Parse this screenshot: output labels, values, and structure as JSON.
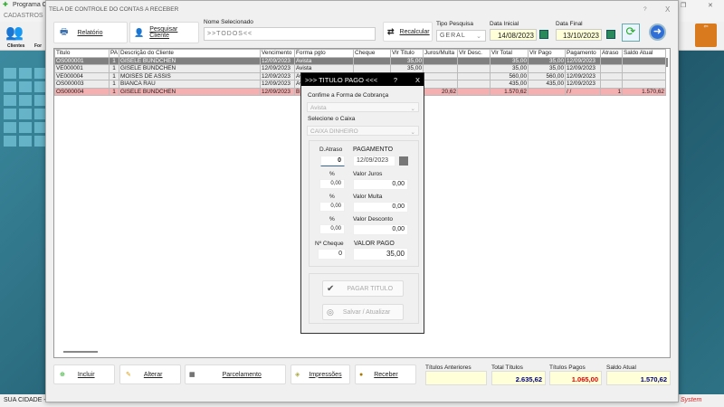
{
  "app": {
    "title": "Programa C",
    "menu": "CADASTROS",
    "tools": [
      "Clientes",
      "For"
    ],
    "status_left": "SUA CIDADE -",
    "status_right": "System"
  },
  "window": {
    "title": "TELA DE CONTROLE DO CONTAS A RECEBER",
    "help": "?",
    "close": "X"
  },
  "toolbar": {
    "relatorio": "Relatório",
    "pesquisar": "Pesquisar Cliente",
    "nome_label": "Nome Selecionado",
    "nome_value": ">>TODOS<<",
    "recalcular": "Recalcular",
    "tipo_label": "Tipo Pesquisa",
    "tipo_value": "GERAL",
    "data_ini_label": "Data Inicial",
    "data_ini": "14/08/2023",
    "data_fim_label": "Data Final",
    "data_fim": "13/10/2023"
  },
  "table": {
    "columns": [
      "Titulo",
      "PA",
      "Descrição do Cliente",
      "Vencimento",
      "Forma pgto",
      "Cheque",
      "Vlr Titulo",
      "Juros/Multa",
      "Vlr Desc.",
      "Vlr Total",
      "Vlr Pago",
      "Pagamento",
      "Atraso",
      "Saldo Atual"
    ],
    "rows": [
      [
        "OS000001",
        "1",
        "GISELE BÜNDCHEN",
        "12/09/2023",
        "Avista",
        "",
        "35,00",
        "",
        "",
        "35,00",
        "35,00",
        "12/09/2023",
        "",
        ""
      ],
      [
        "VE000001",
        "1",
        "GISELE BÜNDCHEN",
        "12/09/2023",
        "Avista",
        "",
        "35,00",
        "",
        "",
        "35,00",
        "35,00",
        "12/09/2023",
        "",
        ""
      ],
      [
        "VE000004",
        "1",
        "MOISÉS DE ASSIS",
        "12/09/2023",
        "Avista",
        "",
        "560,00",
        "",
        "",
        "560,00",
        "560,00",
        "12/09/2023",
        "",
        ""
      ],
      [
        "OS000003",
        "1",
        "BIANCA RAU",
        "12/09/2023",
        "Avista",
        "",
        "435,00",
        "",
        "",
        "435,00",
        "435,00",
        "12/09/2023",
        "",
        ""
      ],
      [
        "OS000004",
        "1",
        "GISELE BÜNDCHEN",
        "12/09/2023",
        "B",
        "",
        "",
        "20,62",
        "",
        "1.570,62",
        "",
        "/ /",
        "1",
        "1.570,62"
      ]
    ]
  },
  "bottom": {
    "incluir": "Incluir",
    "alterar": "Alterar",
    "parcelamento": "Parcelamento",
    "impressoes": "Impressões",
    "receber": "Receber",
    "titulos_anteriores_label": "Títulos Anteriores",
    "titulos_anteriores": "",
    "total_label": "Total Títulos",
    "total": "2.635,62",
    "pagos_label": "Títulos Pagos",
    "pagos": "1.065,00",
    "saldo_label": "Saldo Atual",
    "saldo": "1.570,62"
  },
  "modal": {
    "title": ">>> TITULO PAGO <<<",
    "help": "?",
    "close": "X",
    "forma_label": "Confime a Forma de Cobrança",
    "forma": "Avista",
    "caixa_label": "Selecione o Caixa",
    "caixa": "CAIXA DINHEIRO",
    "atraso_label": "D.Atraso",
    "atraso": "0",
    "pagamento_label": "PAGAMENTO",
    "pagamento": "12/09/2023",
    "pct_label": "%",
    "juros_pct": "0,00",
    "juros_label": "Valor Juros",
    "juros": "0,00",
    "multa_pct": "0,00",
    "multa_label": "Valor Multa",
    "multa": "0,00",
    "desc_pct": "0,00",
    "desc_label": "Valor Desconto",
    "desc": "0,00",
    "cheque_label": "Nº Cheque",
    "cheque": "0",
    "pago_label": "VALOR PAGO",
    "pago": "35,00",
    "pagar_btn": "PAGAR TITULO",
    "salvar_btn": "Salvar / Atualizar"
  },
  "colors": {
    "selected_row": "#808080",
    "overdue_row": "#f4b0b0",
    "pagos_text": "#e00000",
    "total_text": "#000080"
  }
}
